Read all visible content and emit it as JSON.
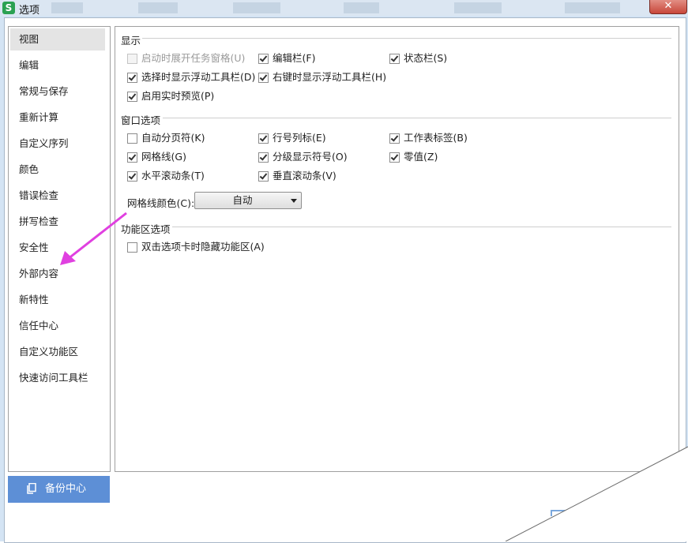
{
  "window": {
    "title": "选项",
    "app_icon_letter": "S",
    "close_label": "✕"
  },
  "sidebar": {
    "items": [
      {
        "label": "视图",
        "active": true
      },
      {
        "label": "编辑"
      },
      {
        "label": "常规与保存"
      },
      {
        "label": "重新计算"
      },
      {
        "label": "自定义序列"
      },
      {
        "label": "颜色"
      },
      {
        "label": "错误检查"
      },
      {
        "label": "拼写检查"
      },
      {
        "label": "安全性"
      },
      {
        "label": "外部内容"
      },
      {
        "label": "新特性"
      },
      {
        "label": "信任中心"
      },
      {
        "label": "自定义功能区"
      },
      {
        "label": "快速访问工具栏"
      }
    ],
    "backup_label": "备份中心"
  },
  "display": {
    "title": "显示",
    "options": [
      {
        "label": "启动时展开任务窗格(U)",
        "checked": false,
        "disabled": true
      },
      {
        "label": "编辑栏(F)",
        "checked": true
      },
      {
        "label": "状态栏(S)",
        "checked": true
      },
      {
        "label": "选择时显示浮动工具栏(D)",
        "checked": true
      },
      {
        "label": "右键时显示浮动工具栏(H)",
        "checked": true
      },
      {
        "label": "启用实时预览(P)",
        "checked": true
      }
    ]
  },
  "window_options": {
    "title": "窗口选项",
    "options": [
      {
        "label": "自动分页符(K)",
        "checked": false
      },
      {
        "label": "行号列标(E)",
        "checked": true
      },
      {
        "label": "工作表标签(B)",
        "checked": true
      },
      {
        "label": "网格线(G)",
        "checked": true
      },
      {
        "label": "分级显示符号(O)",
        "checked": true
      },
      {
        "label": "零值(Z)",
        "checked": true
      },
      {
        "label": "水平滚动条(T)",
        "checked": true
      },
      {
        "label": "垂直滚动条(V)",
        "checked": true
      }
    ],
    "gridline_color_label": "网格线颜色(C):",
    "gridline_color_value": "自动"
  },
  "ribbon_options": {
    "title": "功能区选项",
    "options": [
      {
        "label": "双击选项卡时隐藏功能区(A)",
        "checked": false
      }
    ]
  },
  "colors": {
    "accent": "#5d8fd6",
    "annotation_arrow": "#e040e0",
    "close_button": "#c8473a"
  }
}
